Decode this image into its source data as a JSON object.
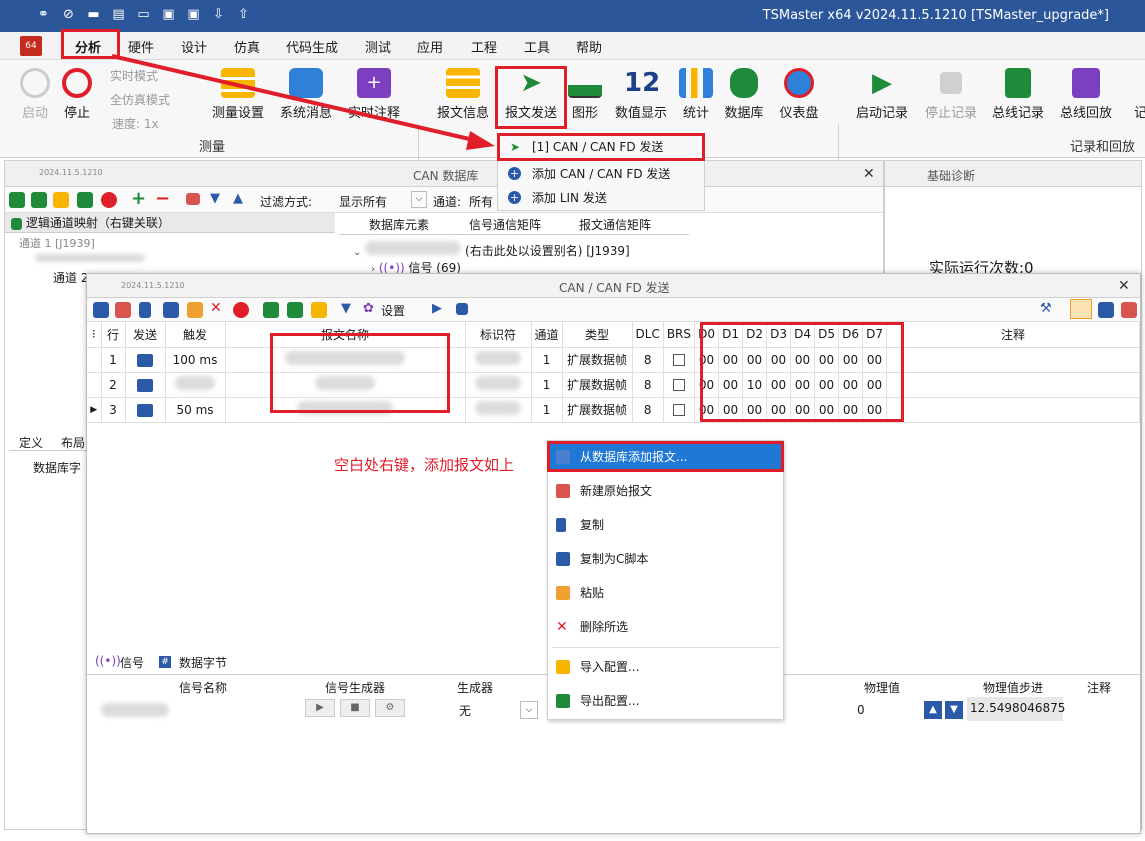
{
  "window": {
    "title": "TSMaster x64 v2024.11.5.1210 [TSMaster_upgrade*]"
  },
  "menu": [
    "分析",
    "硬件",
    "设计",
    "仿真",
    "代码生成",
    "测试",
    "应用",
    "工程",
    "工具",
    "帮助"
  ],
  "ribbon": {
    "left_small": {
      "start": "启动",
      "stop": "停止",
      "realtime": "实时模式",
      "fullsim": "全仿真模式",
      "speed": "速度: 1x"
    },
    "buttons": [
      "测量设置",
      "系统消息",
      "实时注释",
      "报文信息",
      "报文发送",
      "图形",
      "数值显示",
      "统计",
      "数据库",
      "仪表盘",
      "启动记录",
      "停止记录",
      "总线记录",
      "总线回放",
      "记"
    ],
    "group_measure": "测量",
    "group_record": "记录和回放",
    "num_display_icon": "12"
  },
  "send_dropdown": {
    "items": [
      "[1] CAN / CAN FD 发送",
      "添加 CAN / CAN FD 发送",
      "添加 LIN 发送"
    ]
  },
  "can_db_panel": {
    "version": "2024.11.5.1210",
    "title": "CAN 数据库",
    "close": "✕",
    "filter_label": "过滤方式:",
    "filter_value": "显示所有",
    "channel_label": "通道:",
    "channel_value": "所有",
    "tree_header": "逻辑通道映射（右键关联）",
    "tree_items": [
      "通道 1 [J1939]",
      "通道 2"
    ],
    "tabs": [
      "数据库元素",
      "信号通信矩阵",
      "报文通信矩阵"
    ],
    "db_node": "(右击此处以设置别名) [J1939]",
    "signal_node": "信号 (69)",
    "left_tabs": [
      "定义",
      "布局"
    ],
    "left_content": "数据库字"
  },
  "diag_panel": {
    "title": "基础诊断",
    "run_count": "实际运行次数:0"
  },
  "send_window": {
    "version": "2024.11.5.1210",
    "title": "CAN / CAN FD 发送",
    "settings": "设置",
    "columns": [
      "行",
      "发送",
      "触发",
      "报文名称",
      "标识符",
      "通道",
      "类型",
      "DLC",
      "BRS",
      "D0",
      "D1",
      "D2",
      "D3",
      "D4",
      "D5",
      "D6",
      "D7",
      "注释"
    ],
    "rows": [
      {
        "row": "1",
        "trigger": "100 ms",
        "channel": "1",
        "type": "扩展数据帧",
        "dlc": "8",
        "data": [
          "00",
          "00",
          "00",
          "00",
          "00",
          "00",
          "00",
          "00"
        ]
      },
      {
        "row": "2",
        "trigger": "",
        "channel": "1",
        "type": "扩展数据帧",
        "dlc": "8",
        "data": [
          "00",
          "00",
          "10",
          "00",
          "00",
          "00",
          "00",
          "00"
        ]
      },
      {
        "row": "3",
        "trigger": "50 ms",
        "channel": "1",
        "type": "扩展数据帧",
        "dlc": "8",
        "data": [
          "00",
          "00",
          "00",
          "00",
          "00",
          "00",
          "00",
          "00"
        ]
      }
    ],
    "annotation": "空白处右键，添加报文如上",
    "bottom_tabs": [
      "信号",
      "数据字节"
    ],
    "signal_columns": [
      "信号名称",
      "信号生成器",
      "生成器",
      "物理值",
      "物理值步进",
      "注释"
    ],
    "signal_row": {
      "generator": "无",
      "phys_value": "0",
      "phys_step": "12.5498046875"
    }
  },
  "context_menu": {
    "items": [
      "从数据库添加报文...",
      "新建原始报文",
      "复制",
      "复制为C脚本",
      "粘贴",
      "删除所选",
      "导入配置...",
      "导出配置..."
    ]
  },
  "colors": {
    "accent": "#2b579a",
    "red_highlight": "#e01e2a",
    "selected": "#1e78d4"
  }
}
